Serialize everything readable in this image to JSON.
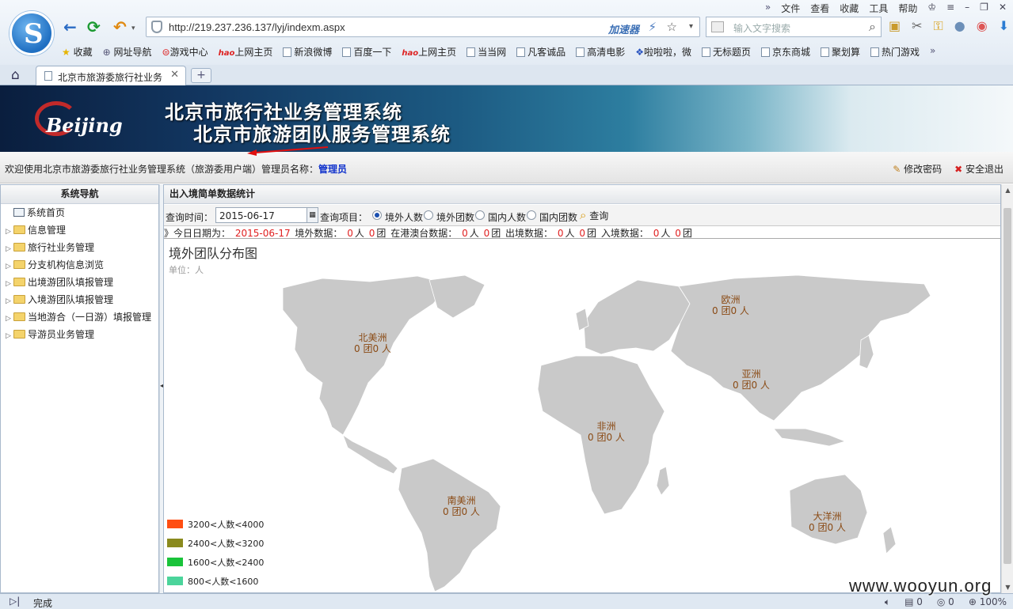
{
  "browser": {
    "menu": [
      "文件",
      "查看",
      "收藏",
      "工具",
      "帮助"
    ],
    "url": "http://219.237.236.137/lyj/indexm.aspx",
    "accelerator": "加速器",
    "search_placeholder": "输入文字搜索",
    "bookmarks": [
      "收藏",
      "网址导航",
      "游戏中心",
      "上网主页",
      "新浪微博",
      "百度一下",
      "上网主页",
      "当当网",
      "凡客诚品",
      "高清电影",
      "啦啦啦，微",
      "无标题页",
      "京东商城",
      "聚划算",
      "热门游戏"
    ],
    "tab_title": "北京市旅游委旅行社业务",
    "status_text": "完成",
    "zoom": "100%",
    "status_counts": [
      "0",
      "0"
    ],
    "logo_letter": "S"
  },
  "banner": {
    "logo_text": "Beijing",
    "title_1": "北京市旅行社业务管理系统",
    "title_2": "北京市旅游团队服务管理系统"
  },
  "welcome": {
    "message": "欢迎使用北京市旅游委旅行社业务管理系统（旅游委用户端）管理员名称：",
    "admin_name": "管理员",
    "change_password": "修改密码",
    "logout": "安全退出"
  },
  "sidebar": {
    "title": "系统导航",
    "home": "系统首页",
    "items": [
      "信息管理",
      "旅行社业务管理",
      "分支机构信息浏览",
      "出境游团队填报管理",
      "入境游团队填报管理",
      "当地游合（一日游）填报管理",
      "导游员业务管理"
    ]
  },
  "main": {
    "panel_title": "出入境简单数据统计",
    "query_time_label": "查询时间：",
    "query_date": "2015-06-17",
    "query_item_label": "查询项目：",
    "options": [
      "境外人数",
      "境外团数",
      "国内人数",
      "国内团数"
    ],
    "selected_option": "境外人数",
    "query_button": "查询",
    "stats": {
      "prefix": "》今日日期为：",
      "date": "2015-06-17",
      "overseas_label": "境外数据：",
      "hkmo_label": "在港澳台数据：",
      "outbound_label": "出境数据：",
      "inbound_label": "入境数据：",
      "unit_people": "人",
      "unit_groups": "团",
      "overseas_people": "0",
      "overseas_groups": "0",
      "hkmo_people": "0",
      "hkmo_groups": "0",
      "outbound_people": "0",
      "outbound_groups": "0",
      "inbound_people": "0",
      "inbound_groups": "0"
    },
    "map_title": "境外团队分布图",
    "map_unit": "单位：人",
    "continents": [
      {
        "name": "北美洲",
        "value": "0 团0 人"
      },
      {
        "name": "欧洲",
        "value": "0 团0 人"
      },
      {
        "name": "亚洲",
        "value": "0 团0 人"
      },
      {
        "name": "非洲",
        "value": "0 团0 人"
      },
      {
        "name": "南美洲",
        "value": "0 团0 人"
      },
      {
        "name": "大洋洲",
        "value": "0 团0 人"
      }
    ],
    "legend": [
      {
        "label": "3200<人数<4000",
        "color": "#ff4e12"
      },
      {
        "label": "2400<人数<3200",
        "color": "#8a8a1e"
      },
      {
        "label": "1600<人数<2400",
        "color": "#19c33a"
      },
      {
        "label": "800<人数<1600",
        "color": "#4bd49b"
      }
    ],
    "land_color": "#c9c9c9"
  },
  "watermark": "www.wooyun.org"
}
